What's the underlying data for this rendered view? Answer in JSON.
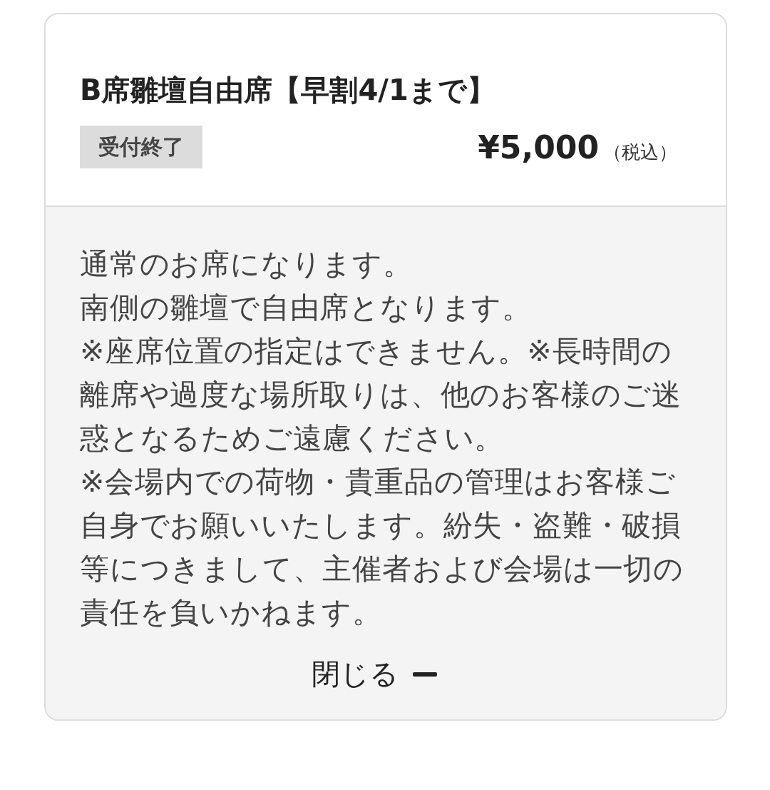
{
  "ticket": {
    "title": "B席雛壇自由席【早割4/1まで】",
    "status": "受付終了",
    "price": "¥5,000",
    "tax_note": "（税込）"
  },
  "details": {
    "expanded": true,
    "paragraphs": [
      "通常のお席になります。",
      "南側の雛壇で自由席となります。",
      "※座席位置の指定はできません。※長時間の離席や過度な場所取りは、他のお客様のご迷惑となるためご遠慮ください。",
      "※会場内での荷物・貴重品の管理はお客様ご自身でお願いいたします。紛失・盗難・破損等につきまして、主催者および会場は一切の責任を負いかねます。"
    ],
    "toggle_label": "閉じる"
  }
}
